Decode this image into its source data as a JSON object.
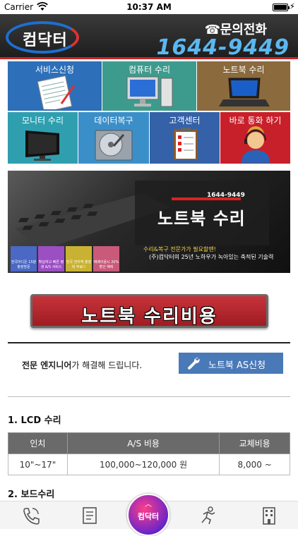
{
  "status_bar": {
    "carrier": "Carrier",
    "time": "10:37 AM"
  },
  "header": {
    "logo_text": "컴닥터",
    "contact_label": "문의전화",
    "contact_number": "1644-9449"
  },
  "menu": [
    {
      "label": "서비스신청",
      "color": "#2d6fb8"
    },
    {
      "label": "컴퓨터 수리",
      "color": "#3d9b8e"
    },
    {
      "label": "노트북 수리",
      "color": "#8b6a3e"
    },
    {
      "label": "모니터 수리",
      "color": "#2f9fb0"
    },
    {
      "label": "데이터복구",
      "color": "#3b8fc9"
    },
    {
      "label": "고객센터",
      "color": "#3561a8"
    },
    {
      "label": "바로 통화 하기",
      "color": "#c8202a"
    }
  ],
  "banner": {
    "small_number": "1644-9449",
    "title": "노트북 수리",
    "sub1": "수리&복구 전문가가 필요할땐!",
    "sub2": "(주)컴닥터의 25년 노하우가 녹아있는 축적된 기술력",
    "badges": [
      {
        "text": "전국어디든 15분 출장방문",
        "color": "#4a68c4"
      },
      {
        "text": "확실하고 빠른 평생 A/S 서비스",
        "color": "#9b4fc2"
      },
      {
        "text": "전국 전지역 출장비 무료!!",
        "color": "#c9b233"
      },
      {
        "text": "택배이용시 20% 할인 혜택",
        "color": "#c95a7a"
      }
    ]
  },
  "cost_button": {
    "label": "노트북 수리비용"
  },
  "engineer": {
    "bold": "전문 엔지니어",
    "rest": "가 해결해 드립니다.",
    "as_button": "노트북 AS신청"
  },
  "sections": {
    "lcd_title": "1. LCD 수리",
    "board_title": "2. 보드수리"
  },
  "table": {
    "headers": [
      "인치",
      "A/S 비용",
      "교체비용"
    ],
    "rows": [
      [
        "10\"~17\"",
        "100,000~120,000 원",
        "8,000 ~"
      ]
    ]
  },
  "tabbar": {
    "center_label": "컴닥터"
  }
}
